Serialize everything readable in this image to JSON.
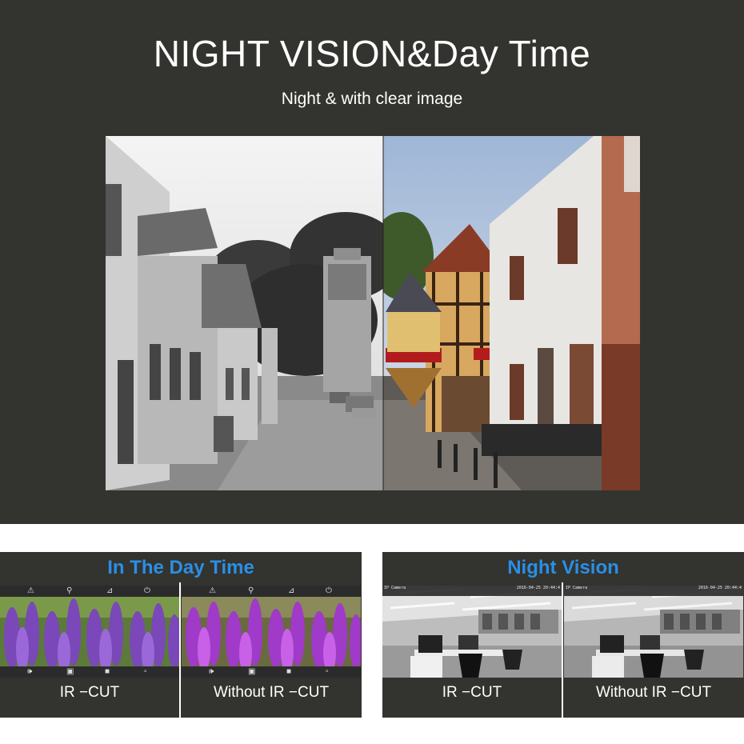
{
  "hero": {
    "title": "NIGHT VISION&Day Time",
    "subtitle": "Night & with clear image"
  },
  "panels": [
    {
      "title": "In The Day Time",
      "title_color": "#2a8fe6",
      "captions": [
        "IR −CUT",
        "Without IR −CUT"
      ],
      "toolbar_icons": [
        "warning-icon",
        "zoom-icon",
        "thermometer-icon",
        "power-icon"
      ],
      "bottom_icons": [
        "speaker-icon",
        "camera-icon",
        "video-icon",
        "clip-icon"
      ]
    },
    {
      "title": "Night Vision",
      "title_color": "#2a8fe6",
      "captions": [
        "IR −CUT",
        "Without IR −CUT"
      ],
      "overlay_left": "IP Camera",
      "overlay_right": "2016-04-25 20:44:4"
    }
  ],
  "colors": {
    "background_dark": "#33332f",
    "accent": "#2a8fe6",
    "text": "#ffffff"
  }
}
